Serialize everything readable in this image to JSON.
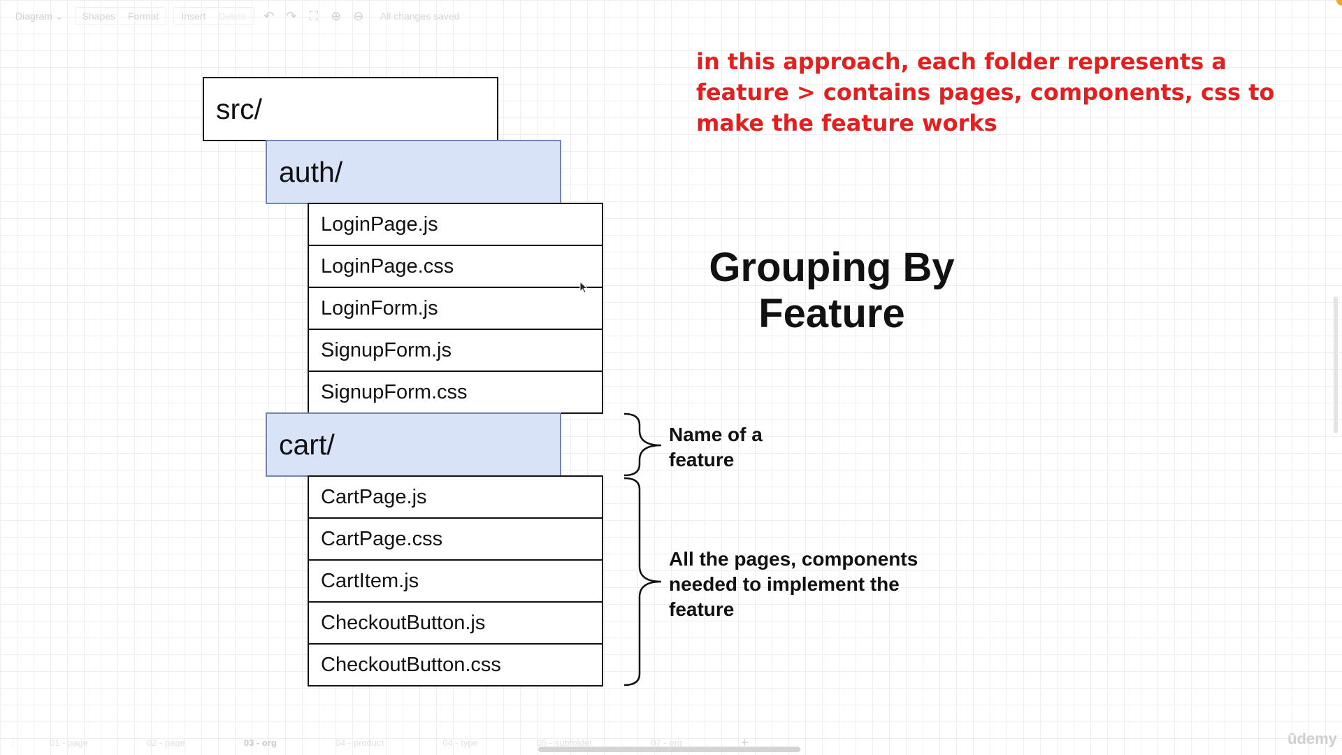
{
  "toolbar": {
    "diagram_menu": "Diagram",
    "shapes_label": "Shapes",
    "format_label": "Format",
    "insert_label": "Insert",
    "delete_label": "Delete",
    "status": "All changes saved"
  },
  "tree": {
    "root": "src/",
    "auth": {
      "folder": "auth/",
      "files": [
        "LoginPage.js",
        "LoginPage.css",
        "LoginForm.js",
        "SignupForm.js",
        "SignupForm.css"
      ]
    },
    "cart": {
      "folder": "cart/",
      "files": [
        "CartPage.js",
        "CartPage.css",
        "CartItem.js",
        "CheckoutButton.js",
        "CheckoutButton.css"
      ]
    }
  },
  "annotation": {
    "note": "in this approach, each folder represents a feature > contains pages, components, css to make the feature works",
    "title": "Grouping By Feature",
    "feature_label": "Name of a feature",
    "contents_label": "All the pages, components needed to implement the feature"
  },
  "page_tabs": [
    "01 - page",
    "02 - page",
    "03 - org",
    "04 - product",
    "04 - type",
    "05 - subfolder",
    "07 - org"
  ],
  "active_tab": "03 - org",
  "watermark": "ūdemy",
  "colors": {
    "folder_fill": "#d9e3f8",
    "folder_border": "#6f86b3",
    "note_red": "#e3201f"
  }
}
